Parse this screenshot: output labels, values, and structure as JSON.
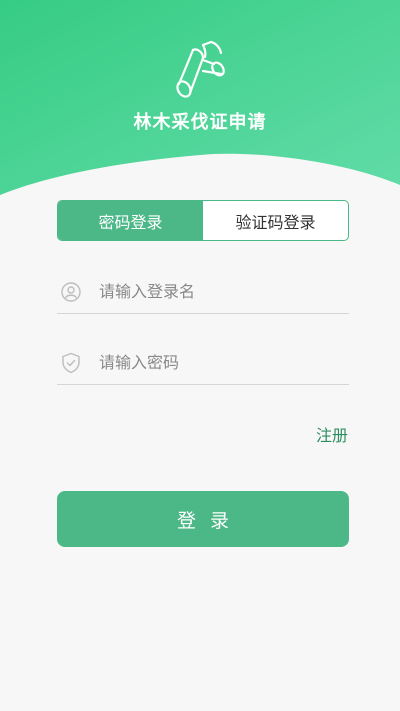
{
  "app": {
    "title": "林木采伐证申请",
    "logo_icon": "log-icon"
  },
  "tabs": [
    {
      "label": "密码登录",
      "active": true
    },
    {
      "label": "验证码登录",
      "active": false
    }
  ],
  "form": {
    "username": {
      "placeholder": "请输入登录名",
      "value": "",
      "icon": "user-icon"
    },
    "password": {
      "placeholder": "请输入密码",
      "value": "",
      "icon": "shield-check-icon"
    }
  },
  "register_label": "注册",
  "login_label": "登录",
  "colors": {
    "header_gradient_start": "#3dd08a",
    "header_gradient_end": "#5fdca4",
    "accent": "#4cb887",
    "link": "#2e8d5f",
    "background": "#f7f7f7"
  }
}
